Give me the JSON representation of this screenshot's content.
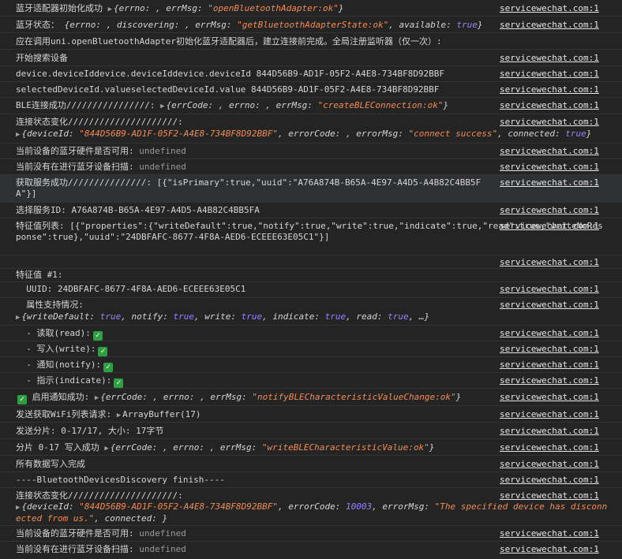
{
  "source": "servicewechat.com:1",
  "colors": {
    "background": "#242424",
    "string": "#f28b54",
    "keyword": "#9980ff",
    "check": "#2ea043"
  },
  "icons": {
    "expand": "triangle-right",
    "check": "green-check-mark"
  },
  "logs": {
    "l1": {
      "text": "蓝牙适配器初始化成功",
      "obj": "{errno: , errMsg: ",
      "s": "\"openBluetoothAdapter:ok\"",
      "end": "}"
    },
    "l2": {
      "text": "蓝牙状态：",
      "obj": "{errno: , discovering: , errMsg: ",
      "s": "\"getBluetoothAdapterState:ok\"",
      "mid": ", available: ",
      "v": "true",
      "end": "}"
    },
    "l3": {
      "text": "应在调用uni.openBluetoothAdapter初始化蓝牙适配器后，建立连接前完成。全局注册监听器（仅一次）:"
    },
    "l4": {
      "text": "开始搜索设备"
    },
    "l5": {
      "text": "device.deviceIddevice.deviceIddevice.deviceId 844D56B9-AD1F-05F2-A4E8-734BF8D92BBF"
    },
    "l6": {
      "text": "selectedDeviceId.valueselectedDeviceId.value 844D56B9-AD1F-05F2-A4E8-734BF8D92BBF"
    },
    "l7": {
      "text": "BLE连接成功////////////////:",
      "obj": "{errCode: , errno: , errMsg: ",
      "s": "\"createBLEConnection:ok\"",
      "end": "}"
    },
    "l8": {
      "text": "连接状态变化/////////////////////:",
      "obj": "{deviceId: ",
      "s": "\"844D56B9-AD1F-05F2-A4E8-734BF8D92BBF\"",
      "mid": ", errorCode: , errorMsg: ",
      "s2": "\"connect success\"",
      "mid2": ", connected: ",
      "v": "true",
      "end": "}"
    },
    "l9": {
      "text": "当前设备的蓝牙硬件是否可用:",
      "v": "undefined"
    },
    "l10": {
      "text": "当前没有在进行蓝牙设备扫描:",
      "v": "undefined"
    },
    "l11": {
      "text": "获取服务成功///////////////: [{\"isPrimary\":true,\"uuid\":\"A76A874B-B65A-4E97-A4D5-A4B82C4BB5FA\"}]"
    },
    "l12": {
      "text": "选择服务ID: A76A874B-B65A-4E97-A4D5-A4B82C4BB5FA"
    },
    "l13": {
      "text": "特征值列表: [{\"properties\":{\"writeDefault\":true,\"notify\":true,\"write\":true,\"indicate\":true,\"read\":true,\"writeNoResponse\":true},\"uuid\":\"24DBFAFC-8677-4F8A-AED6-ECEEE63E05C1\"}]"
    },
    "l14": {
      "text": ""
    },
    "l15": {
      "text": "特征值 #1:"
    },
    "l16": {
      "text": "  UUID: 24DBFAFC-8677-4F8A-AED6-ECEEE63E05C1"
    },
    "l17": {
      "text": "  属性支持情况:",
      "obj": "{writeDefault: ",
      "v1": "true",
      "a": ", notify: ",
      "v2": "true",
      "b": ", write: ",
      "v3": "true",
      "c": ", indicate: ",
      "v4": "true",
      "d": ", read: ",
      "v5": "true",
      "end": ", …}"
    },
    "l18": {
      "text": "  - 读取(read):"
    },
    "l19": {
      "text": "  - 写入(write):"
    },
    "l20": {
      "text": "  - 通知(notify):"
    },
    "l21": {
      "text": "  - 指示(indicate):"
    },
    "l22": {
      "text": " 启用通知成功:",
      "obj": "{errCode: , errno: , errMsg: ",
      "s": "\"notifyBLECharacteristicValueChange:ok\"",
      "end": "}"
    },
    "l23": {
      "text": "发送获取WiFi列表请求:",
      "obj": "ArrayBuffer(17)"
    },
    "l24": {
      "text": "发送分片: 0-17/17, 大小: 17字节"
    },
    "l25": {
      "text": "分片 0-17 写入成功",
      "obj": "{errCode: , errno: , errMsg: ",
      "s": "\"writeBLECharacteristicValue:ok\"",
      "end": "}"
    },
    "l26": {
      "text": "所有数据写入完成"
    },
    "l27": {
      "text": "----BluetoothDevicesDiscovery finish----"
    },
    "l28": {
      "text": "连接状态变化/////////////////////:",
      "obj": "{deviceId: ",
      "s": "\"844D56B9-AD1F-05F2-A4E8-734BF8D92BBF\"",
      "mid": ", errorCode: ",
      "n": "10003",
      "mid2": ", errorMsg: ",
      "s2": "\"The specified device has disconnected from us.\"",
      "mid3": ", connected: ",
      "end": "}"
    },
    "l29": {
      "text": "当前设备的蓝牙硬件是否可用:",
      "v": "undefined"
    },
    "l30": {
      "text": "当前没有在进行蓝牙设备扫描:",
      "v": "undefined"
    }
  }
}
